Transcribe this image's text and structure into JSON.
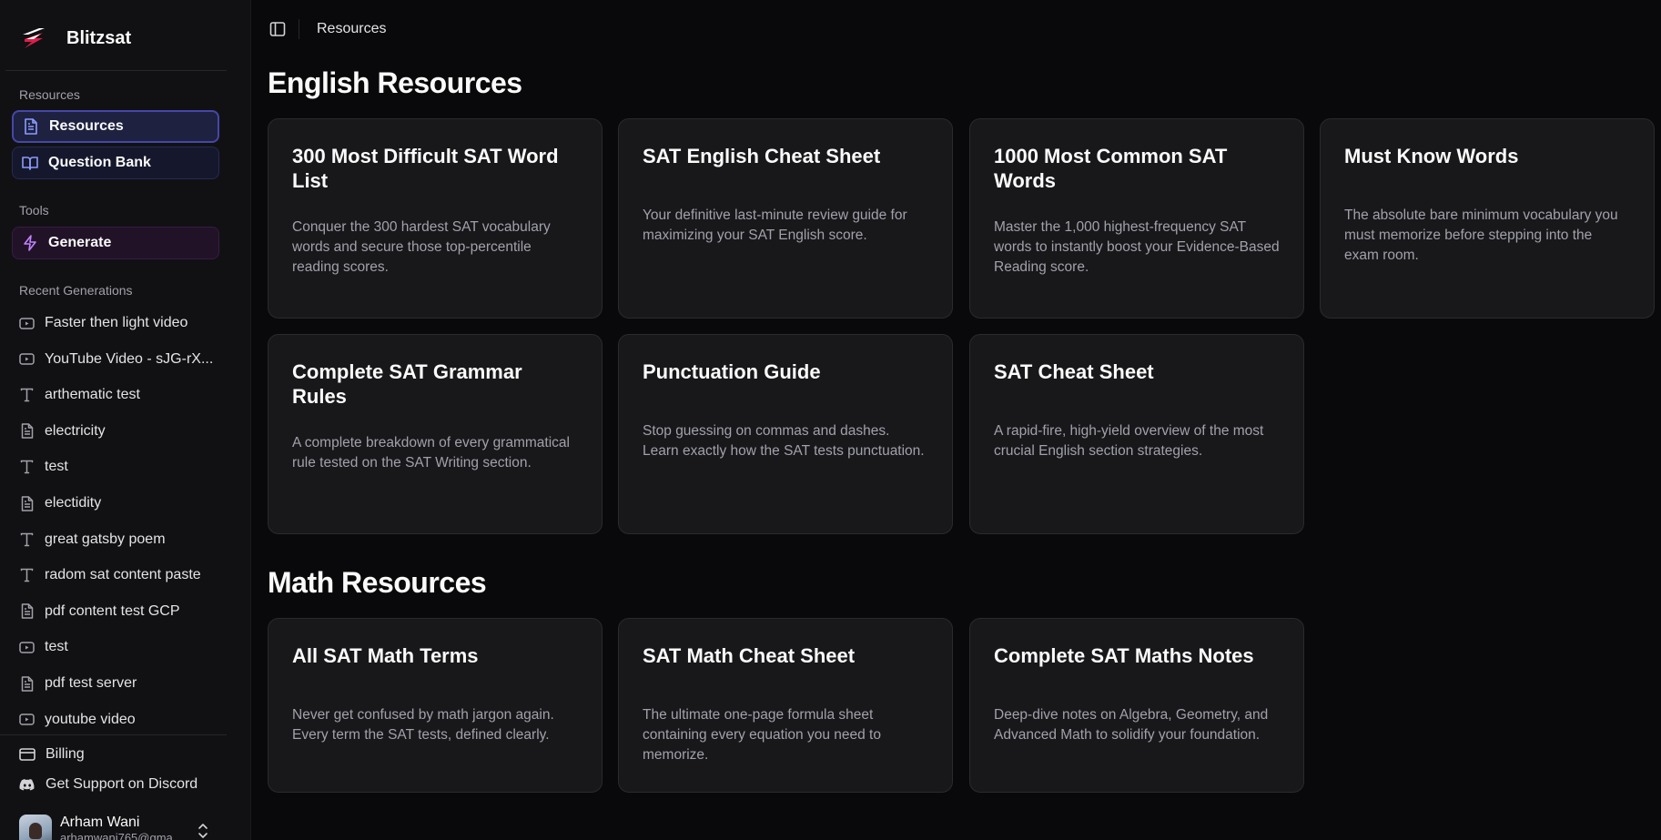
{
  "brand": {
    "name": "Blitzsat",
    "accent": "#e11d48"
  },
  "sidebar": {
    "group_resources": "Resources",
    "nav": {
      "resources": "Resources",
      "question_bank": "Question Bank"
    },
    "group_tools": "Tools",
    "generate": "Generate",
    "group_recent": "Recent Generations",
    "recent": [
      {
        "label": "Faster then light video",
        "icon": "video-icon"
      },
      {
        "label": "YouTube Video - sJG-rX...",
        "icon": "video-icon"
      },
      {
        "label": "arthematic test",
        "icon": "text-icon"
      },
      {
        "label": "electricity",
        "icon": "document-icon"
      },
      {
        "label": "test",
        "icon": "text-icon"
      },
      {
        "label": "electidity",
        "icon": "document-icon"
      },
      {
        "label": "great gatsby poem",
        "icon": "text-icon"
      },
      {
        "label": "radom sat content paste",
        "icon": "text-icon"
      },
      {
        "label": "pdf content test GCP",
        "icon": "document-icon"
      },
      {
        "label": "test",
        "icon": "video-icon"
      },
      {
        "label": "pdf test server",
        "icon": "document-icon"
      },
      {
        "label": "youtube video",
        "icon": "video-icon"
      }
    ],
    "billing": "Billing",
    "support": "Get Support on Discord",
    "user": {
      "name": "Arham Wani",
      "email": "arhamwani765@gma..."
    }
  },
  "header": {
    "breadcrumb": "Resources"
  },
  "english": {
    "title": "English Resources",
    "cards": [
      {
        "title": "300 Most Difficult SAT Word List",
        "desc": "Conquer the 300 hardest SAT vocabulary words and secure those top-percentile reading scores."
      },
      {
        "title": "SAT English Cheat Sheet",
        "desc": "Your definitive last-minute review guide for maximizing your SAT English score."
      },
      {
        "title": "1000 Most Common SAT Words",
        "desc": "Master the 1,000 highest-frequency SAT words to instantly boost your Evidence-Based Reading score."
      },
      {
        "title": "Must Know Words",
        "desc": "The absolute bare minimum vocabulary you must memorize before stepping into the exam room."
      },
      {
        "title": "Complete SAT Grammar Rules",
        "desc": "A complete breakdown of every grammatical rule tested on the SAT Writing section."
      },
      {
        "title": "Punctuation Guide",
        "desc": "Stop guessing on commas and dashes. Learn exactly how the SAT tests punctuation."
      },
      {
        "title": "SAT Cheat Sheet",
        "desc": "A rapid-fire, high-yield overview of the most crucial English section strategies."
      }
    ]
  },
  "math": {
    "title": "Math Resources",
    "cards": [
      {
        "title": "All SAT Math Terms",
        "desc": "Never get confused by math jargon again. Every term the SAT tests, defined clearly."
      },
      {
        "title": "SAT Math Cheat Sheet",
        "desc": "The ultimate one-page formula sheet containing every equation you need to memorize."
      },
      {
        "title": "Complete SAT Maths Notes",
        "desc": "Deep-dive notes on Algebra, Geometry, and Advanced Math to solidify your foundation."
      }
    ]
  }
}
